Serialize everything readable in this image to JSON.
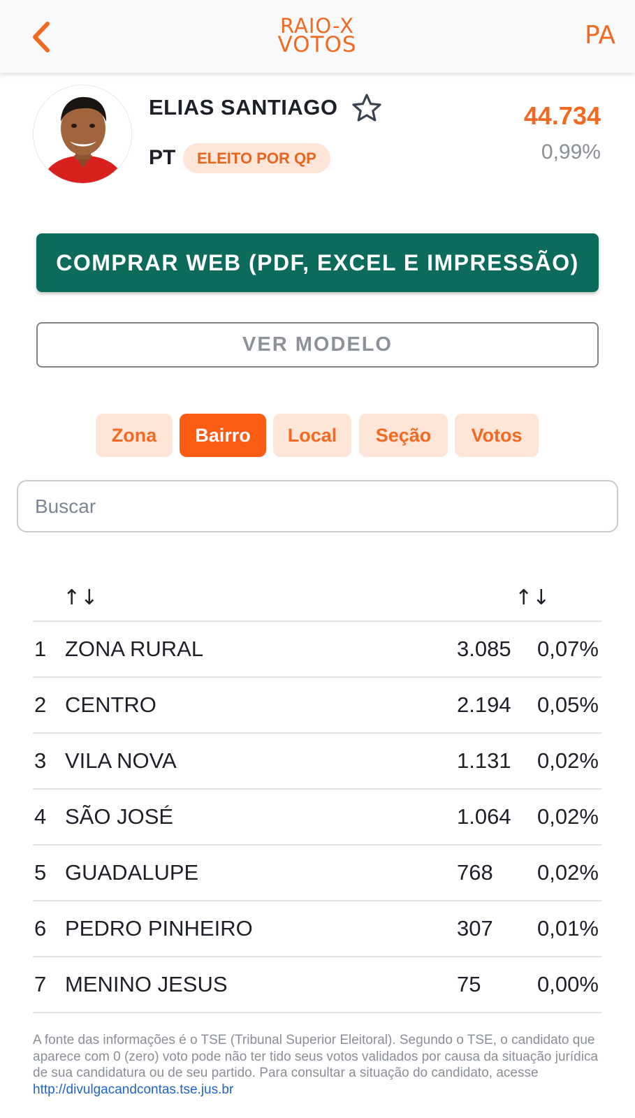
{
  "header": {
    "back_icon": "chevron-left-icon",
    "logo_line1": "RAIO-X",
    "logo_line2": "VOTOS",
    "state": "PA",
    "accent_color": "#f26a21"
  },
  "candidate": {
    "name": "ELIAS SANTIAGO",
    "party": "PT",
    "status_badge": "ELEITO POR QP",
    "total_votes": "44.734",
    "total_pct": "0,99%",
    "favorite_icon": "star-outline-icon"
  },
  "actions": {
    "buy_label": "COMPRAR WEB (PDF, EXCEL E IMPRESSÃO)",
    "buy_color": "#0d6b5b",
    "model_label": "VER MODELO"
  },
  "tabs": [
    {
      "label": "Zona",
      "active": false
    },
    {
      "label": "Bairro",
      "active": true
    },
    {
      "label": "Local",
      "active": false
    },
    {
      "label": "Seção",
      "active": false
    },
    {
      "label": "Votos",
      "active": false
    }
  ],
  "search": {
    "placeholder": "Buscar",
    "value": ""
  },
  "table": {
    "sort_icon": "↑↓",
    "rows": [
      {
        "rank": "1",
        "bairro": "ZONA RURAL",
        "votes": "3.085",
        "pct": "0,07%"
      },
      {
        "rank": "2",
        "bairro": "CENTRO",
        "votes": "2.194",
        "pct": "0,05%"
      },
      {
        "rank": "3",
        "bairro": "VILA NOVA",
        "votes": "1.131",
        "pct": "0,02%"
      },
      {
        "rank": "4",
        "bairro": "SÃO JOSÉ",
        "votes": "1.064",
        "pct": "0,02%"
      },
      {
        "rank": "5",
        "bairro": "GUADALUPE",
        "votes": "768",
        "pct": "0,02%"
      },
      {
        "rank": "6",
        "bairro": "PEDRO PINHEIRO",
        "votes": "307",
        "pct": "0,01%"
      },
      {
        "rank": "7",
        "bairro": "MENINO JESUS",
        "votes": "75",
        "pct": "0,00%"
      }
    ]
  },
  "footnote": {
    "text": "A fonte das informações é o TSE (Tribunal Superior Eleitoral). Segundo o TSE, o candidato que aparece com 0 (zero) voto pode não ter tido seus votos validados por causa da situação jurídica de sua candidatura ou de seu partido. Para consultar a situação do candidato, acesse ",
    "link": "http://divulgacandcontas.tse.jus.br"
  }
}
